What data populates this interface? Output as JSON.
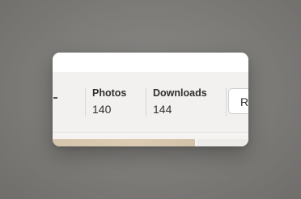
{
  "stats": {
    "photos": {
      "label": "Photos",
      "value": "140"
    },
    "downloads": {
      "label": "Downloads",
      "value": "144"
    }
  },
  "actions": {
    "partial_button_label": "R"
  },
  "colors": {
    "backdrop": "#7c7b78",
    "card_background": "#ffffff",
    "stats_bar_background": "#f2f1ef",
    "text": "#2f2e2c",
    "divider": "#d7d6d3",
    "thumbnail": "#d6c5ad"
  }
}
